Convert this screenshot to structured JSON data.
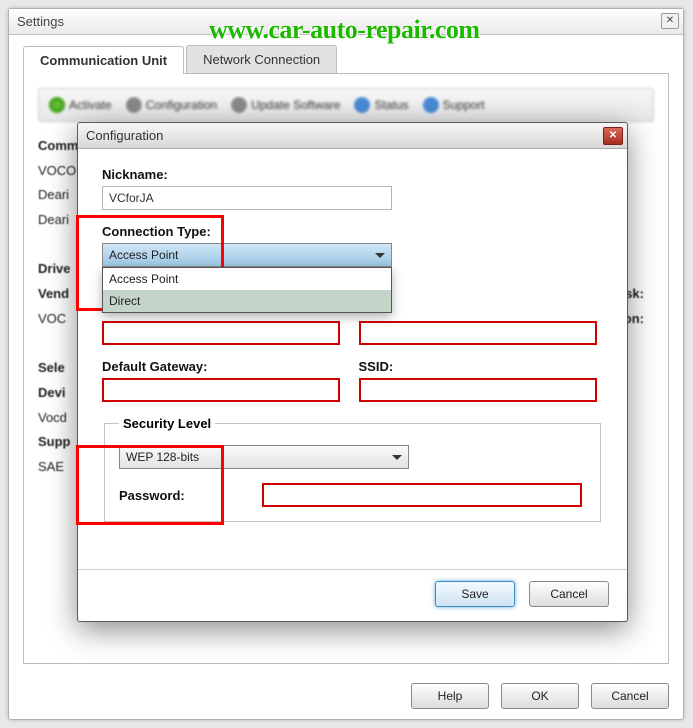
{
  "window": {
    "title": "Settings",
    "watermark": "www.car-auto-repair.com",
    "tabs": {
      "comm": "Communication Unit",
      "net": "Network Connection"
    },
    "toolbar": {
      "activate": "Activate",
      "configure": "Configuration",
      "update": "Update Software",
      "status": "Status",
      "support": "Support"
    },
    "bg": {
      "comm": "Comm",
      "voco": "VOCO",
      "deari1": "Deari",
      "deari2": "Deari",
      "drive": "Drive",
      "vend": "Vend",
      "voc": "VOC",
      "sel": "Sele",
      "devi": "Devi",
      "vocd": "Vocd",
      "supp": "Supp",
      "sae": "SAE",
      "sk": "sk:",
      "on": "on:"
    },
    "buttons": {
      "help": "Help",
      "ok": "OK",
      "cancel": "Cancel"
    }
  },
  "dialog": {
    "title": "Configuration",
    "nickname_label": "Nickname:",
    "nickname_value": "VCforJA",
    "conntype_label": "Connection Type:",
    "conntype_value": "Access Point",
    "dropdown": {
      "opt1": "Access Point",
      "opt2": "Direct"
    },
    "gateway_label": "Default Gateway:",
    "ssid_label": "SSID:",
    "security_legend": "Security Level",
    "security_value": "WEP 128-bits",
    "password_label": "Password:",
    "save": "Save",
    "cancel": "Cancel"
  }
}
